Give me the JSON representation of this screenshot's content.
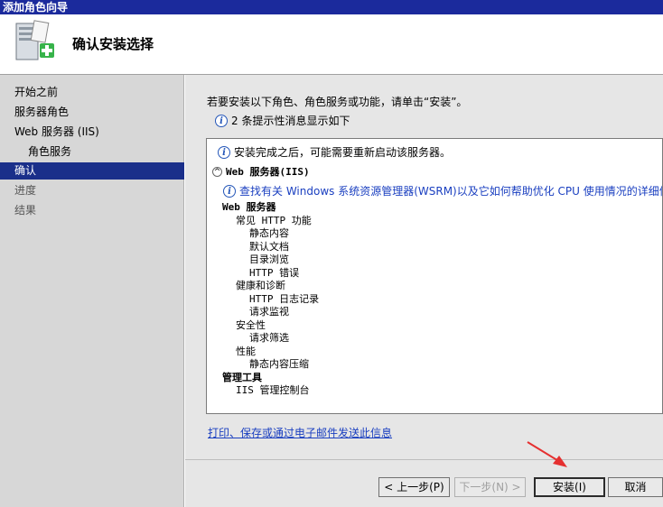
{
  "window": {
    "title": "添加角色向导"
  },
  "header": {
    "title": "确认安装选择",
    "icon": "server-add-icon"
  },
  "sidebar": {
    "items": [
      {
        "label": "开始之前",
        "state": "normal"
      },
      {
        "label": "服务器角色",
        "state": "normal"
      },
      {
        "label": "Web 服务器 (IIS)",
        "state": "normal"
      },
      {
        "label": "角色服务",
        "state": "sub"
      },
      {
        "label": "确认",
        "state": "active"
      },
      {
        "label": "进度",
        "state": "disabled"
      },
      {
        "label": "结果",
        "state": "disabled"
      }
    ]
  },
  "main": {
    "intro": "若要安装以下角色、角色服务或功能，请单击“安装”。",
    "info_count": "2 条提示性消息显示如下",
    "results": {
      "restart_msg": "安装完成之后，可能需要重新启动该服务器。",
      "section_title": "Web 服务器(IIS)",
      "wsrm_msg": "查找有关 Windows 系统资源管理器(WSRM)以及它如何帮助优化 CPU 使用情况的详细信息",
      "tree": [
        {
          "text": "Web 服务器",
          "level": 0,
          "bold": true
        },
        {
          "text": "常见 HTTP 功能",
          "level": 1
        },
        {
          "text": "静态内容",
          "level": 2
        },
        {
          "text": "默认文档",
          "level": 2
        },
        {
          "text": "目录浏览",
          "level": 2
        },
        {
          "text": "HTTP 错误",
          "level": 2
        },
        {
          "text": "健康和诊断",
          "level": 1
        },
        {
          "text": "HTTP 日志记录",
          "level": 2
        },
        {
          "text": "请求监视",
          "level": 2
        },
        {
          "text": "安全性",
          "level": 1
        },
        {
          "text": "请求筛选",
          "level": 2
        },
        {
          "text": "性能",
          "level": 1
        },
        {
          "text": "静态内容压缩",
          "level": 2
        },
        {
          "text": "管理工具",
          "level": 0,
          "bold": true
        },
        {
          "text": "IIS 管理控制台",
          "level": 1
        }
      ]
    },
    "print_link": "打印、保存或通过电子邮件发送此信息"
  },
  "buttons": {
    "back": "< 上一步(P)",
    "next": "下一步(N) >",
    "install": "安装(I)",
    "cancel": "取消"
  },
  "colors": {
    "active_nav": "#1a2f8a",
    "titlebar": "#1b2a9c",
    "link": "#1a3fc0",
    "annotation_arrow": "#e53030"
  }
}
